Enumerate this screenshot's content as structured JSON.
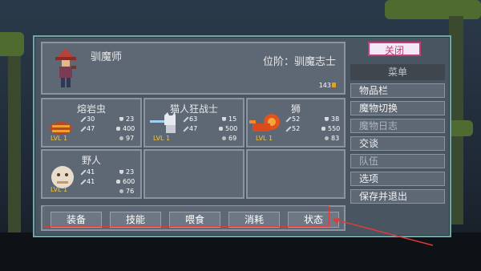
{
  "header": {
    "name": "驯魔师",
    "rank": "位阶：驯魔志士",
    "coins": "143"
  },
  "slots": [
    {
      "name": "熔岩虫",
      "level": "LVL 1",
      "atk": "30",
      "def": "23",
      "hp_a": "47",
      "hp_b": "400",
      "food": "97"
    },
    {
      "name": "猫人狂战士",
      "level": "LVL 1",
      "atk": "63",
      "def": "15",
      "hp_a": "47",
      "hp_b": "500",
      "food": "69"
    },
    {
      "name": "狮",
      "level": "LVL 1",
      "atk": "52",
      "def": "38",
      "hp_a": "52",
      "hp_b": "550",
      "food": "83"
    },
    {
      "name": "野人",
      "level": "LVL 1",
      "atk": "41",
      "def": "23",
      "hp_a": "41",
      "hp_b": "600",
      "food": "76"
    }
  ],
  "menu": {
    "close": "关闭",
    "title": "菜单",
    "items": [
      "物品栏",
      "魔物切换",
      "魔物日志",
      "交谈",
      "队伍",
      "选项",
      "保存并退出"
    ]
  },
  "bottom": [
    "装备",
    "技能",
    "喂食",
    "消耗",
    "状态"
  ],
  "colors": {
    "highlight": "#e03a3a",
    "close": "#c43c7a",
    "panel_border": "#6fa7a8"
  }
}
